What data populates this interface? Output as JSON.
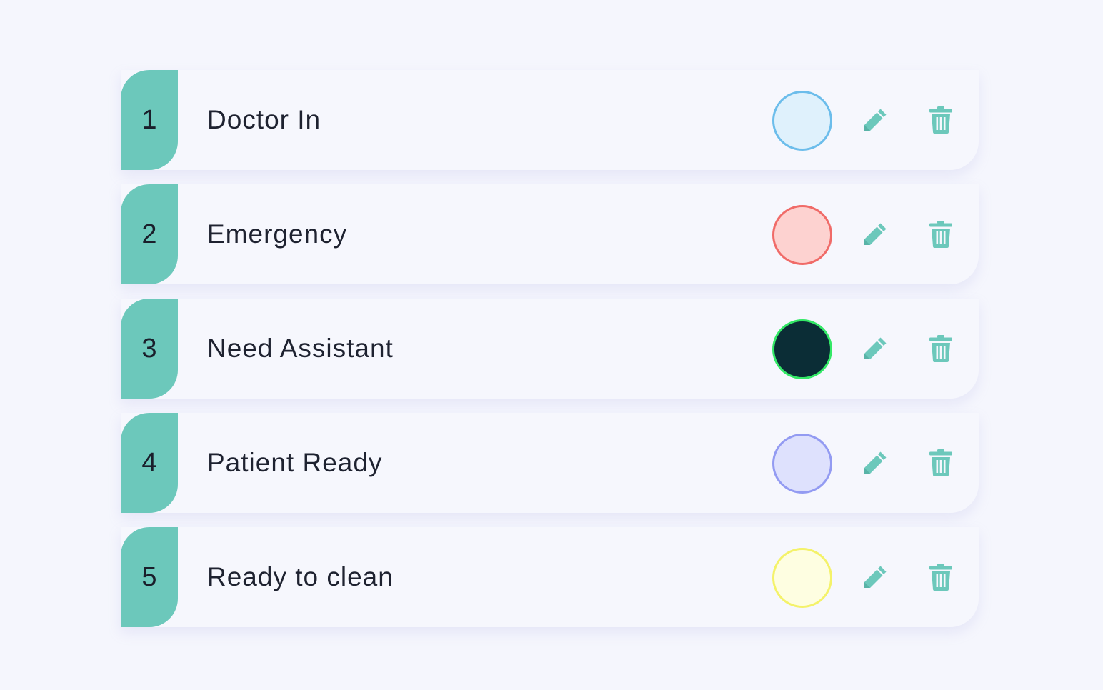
{
  "status_list": {
    "items": [
      {
        "number": "1",
        "label": "Doctor In",
        "fill": "#dff1fc",
        "border": "#6cbdeb"
      },
      {
        "number": "2",
        "label": "Emergency",
        "fill": "#fdd2d0",
        "border": "#f06b68"
      },
      {
        "number": "3",
        "label": "Need Assistant",
        "fill": "#0b2d36",
        "border": "#33e866"
      },
      {
        "number": "4",
        "label": "Patient Ready",
        "fill": "#dee1fd",
        "border": "#939bf2"
      },
      {
        "number": "5",
        "label": "Ready to clean",
        "fill": "#fefee1",
        "border": "#f4f26a"
      }
    ],
    "accent_color": "#6cc8bb",
    "icons": {
      "edit": "pencil-icon",
      "delete": "trash-icon"
    }
  }
}
